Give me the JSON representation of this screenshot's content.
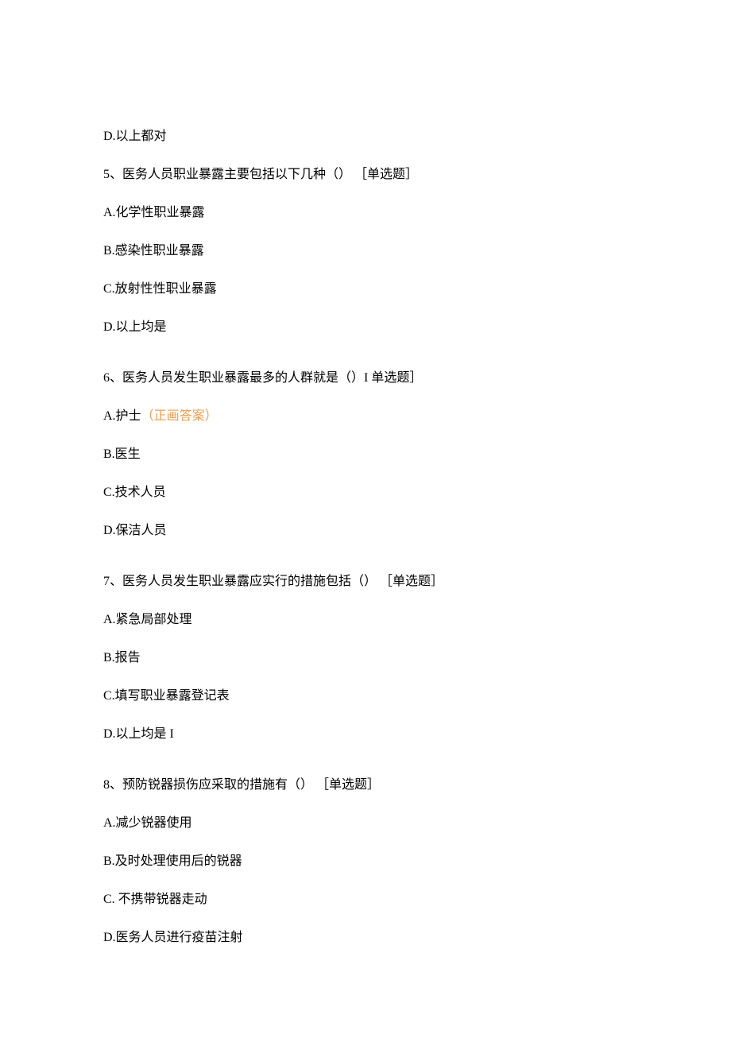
{
  "q4": {
    "optD": "D.以上都对"
  },
  "q5": {
    "stem": "5、医务人员职业暴露主要包括以下几种（） ［单选题］",
    "optA": "A.化学性职业暴露",
    "optB": "B.感染性职业暴露",
    "optC": "C.放射性性职业暴露",
    "optD": "D.以上均是"
  },
  "q6": {
    "stem": "6、医务人员发生职业暴露最多的人群就是（）I 单选题］",
    "optA_prefix": "A.护士",
    "optA_tag": "（正画答案）",
    "optB": "B.医生",
    "optC": "C.技术人员",
    "optD": "D.保洁人员"
  },
  "q7": {
    "stem": "7、医务人员发生职业暴露应实行的措施包括（） ［单选题］",
    "optA": "A.紧急局部处理",
    "optB": "B.报告",
    "optC": "C.填写职业暴露登记表",
    "optD": "D.以上均是 I"
  },
  "q8": {
    "stem": "8、预防锐器损伤应采取的措施有（） ［单选题］",
    "optA": "A.减少锐器使用",
    "optB": "B.及时处理使用后的锐器",
    "optC": "C. 不携带锐器走动",
    "optD": "D.医务人员进行疫苗注射"
  }
}
